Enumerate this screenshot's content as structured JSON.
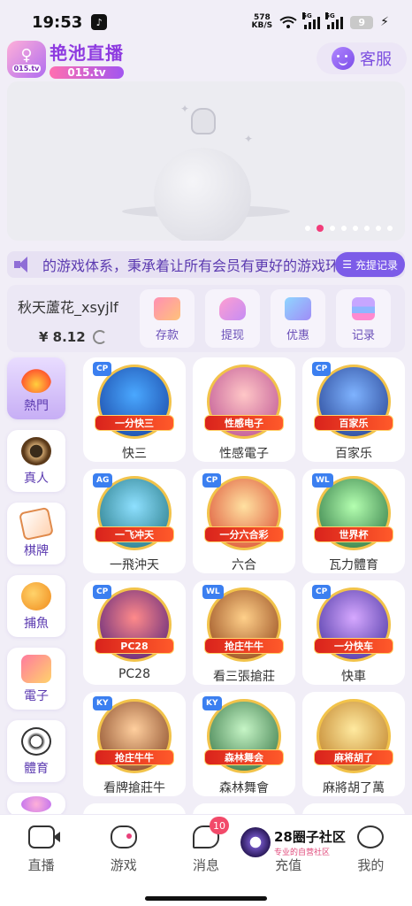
{
  "status_bar": {
    "time": "19:53",
    "speed": "578",
    "speed_unit": "KB/S",
    "sig1": "5G",
    "sig2": "5G",
    "battery": "9"
  },
  "header": {
    "logo_text": "艳池直播",
    "logo_url": "015.tv",
    "logo_small": "015.tv",
    "cs_label": "客服"
  },
  "banner": {
    "active_dot": 1,
    "dot_count": 8
  },
  "marquee": {
    "text": "的游戏体系，秉承着让所有会员有更好的游戏环",
    "record_label": "充提记录"
  },
  "user": {
    "name": "秋天蘆花_xsyjlf",
    "balance": "¥ 8.12"
  },
  "actions": [
    {
      "label": "存款",
      "icon": "deposit-icon"
    },
    {
      "label": "提现",
      "icon": "withdraw-icon"
    },
    {
      "label": "优惠",
      "icon": "gift-icon"
    },
    {
      "label": "记录",
      "icon": "record-icon"
    }
  ],
  "categories": [
    {
      "label": "熱門",
      "icon": "fire-icon"
    },
    {
      "label": "真人",
      "icon": "live-casino-icon"
    },
    {
      "label": "棋牌",
      "icon": "cards-icon"
    },
    {
      "label": "捕魚",
      "icon": "fish-icon"
    },
    {
      "label": "電子",
      "icon": "electronic-icon"
    },
    {
      "label": "體育",
      "icon": "soccer-icon"
    }
  ],
  "games": [
    {
      "name": "快三",
      "ribbon": "一分快三"
    },
    {
      "name": "性感電子",
      "ribbon": "性感电子"
    },
    {
      "name": "百家乐",
      "ribbon": "百家乐"
    },
    {
      "name": "一飛沖天",
      "ribbon": "一飞冲天"
    },
    {
      "name": "六合",
      "ribbon": "一分六合彩"
    },
    {
      "name": "瓦力體育",
      "ribbon": "世界杯"
    },
    {
      "name": "PC28",
      "ribbon": "PC28"
    },
    {
      "name": "看三張搶莊",
      "ribbon": "抢庄牛牛"
    },
    {
      "name": "快車",
      "ribbon": "一分快车"
    },
    {
      "name": "看牌搶莊牛",
      "ribbon": "抢庄牛牛"
    },
    {
      "name": "森林舞會",
      "ribbon": "森林舞会"
    },
    {
      "name": "麻將胡了萬",
      "ribbon": "麻将胡了"
    }
  ],
  "nav": {
    "live": "直播",
    "game": "游戏",
    "msg": "消息",
    "msg_badge": "10",
    "charge": "充值",
    "mine": "我的"
  },
  "watermark": {
    "title": "28圈子社区",
    "sub": "专业的自营社区"
  }
}
